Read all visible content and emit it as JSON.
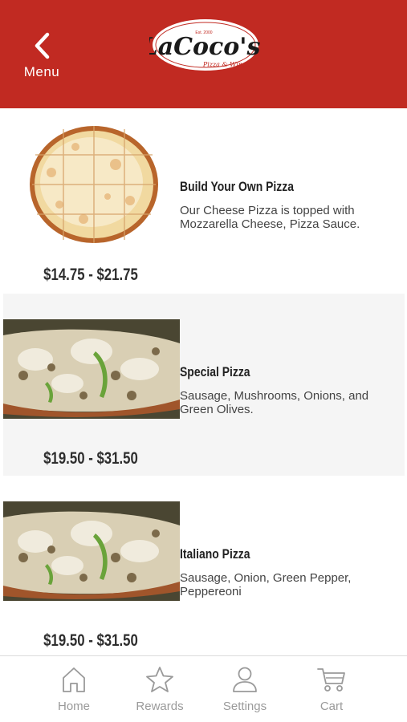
{
  "header": {
    "back_label": "Menu",
    "bg_color": "#c12a22",
    "logo": {
      "text": "LaCoco's",
      "tagline": "Pizza & Wings",
      "est": "Est. 2000"
    }
  },
  "menu_items": [
    {
      "name": "Build Your Own Pizza",
      "description": "Our Cheese Pizza is topped with Mozzarella Cheese, Pizza Sauce.",
      "price": "$14.75 - $21.75"
    },
    {
      "name": "Special Pizza",
      "description": "Sausage, Mushrooms, Onions, and Green Olives.",
      "price": "$19.50 - $31.50"
    },
    {
      "name": "Italiano Pizza",
      "description": "Sausage, Onion, Green Pepper, Peppereoni",
      "price": "$19.50 - $31.50"
    }
  ],
  "tabbar": {
    "tabs": [
      {
        "label": "Home",
        "icon": "home-icon"
      },
      {
        "label": "Rewards",
        "icon": "star-icon"
      },
      {
        "label": "Settings",
        "icon": "person-icon"
      },
      {
        "label": "Cart",
        "icon": "cart-icon"
      }
    ]
  }
}
